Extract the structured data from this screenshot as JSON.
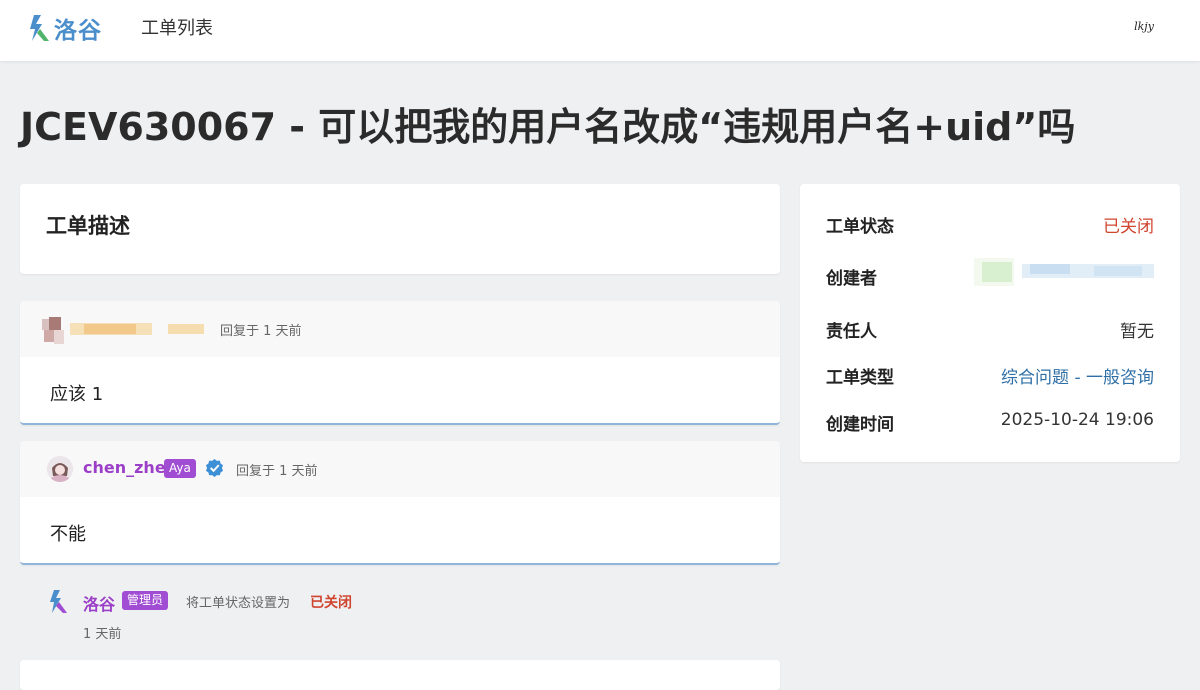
{
  "app": {
    "logo_text": "洛谷",
    "nav_link": "工单列表",
    "user_avatar_text": "lkjy"
  },
  "page": {
    "title": "JCEV630067 - 可以把我的用户名改成“违规用户名+uid”吗"
  },
  "description": {
    "heading": "工单描述"
  },
  "replies": [
    {
      "meta": "回复于 1 天前",
      "body": "应该 1"
    },
    {
      "username": "chen_zhe",
      "badge": "Aya",
      "meta": "回复于 1 天前",
      "body": "不能"
    }
  ],
  "event": {
    "username": "洛谷",
    "badge": "管理员",
    "action": "将工单状态设置为",
    "status": "已关闭",
    "time": "1 天前"
  },
  "details": [
    {
      "label": "工单状态",
      "value": "已关闭"
    },
    {
      "label": "创建者",
      "value": ""
    },
    {
      "label": "责任人",
      "value": "暂无"
    },
    {
      "label": "工单类型",
      "value": "综合问题 - 一般咨询"
    },
    {
      "label": "创建时间",
      "value": "2025-10-24 19:06"
    }
  ],
  "colors": {
    "accent_blue": "#4a8ecb",
    "status_red": "#d0452f",
    "username_purple": "#9b3fc8",
    "badge_purple": "#a04cd3",
    "link_blue": "#2f6fa6"
  }
}
